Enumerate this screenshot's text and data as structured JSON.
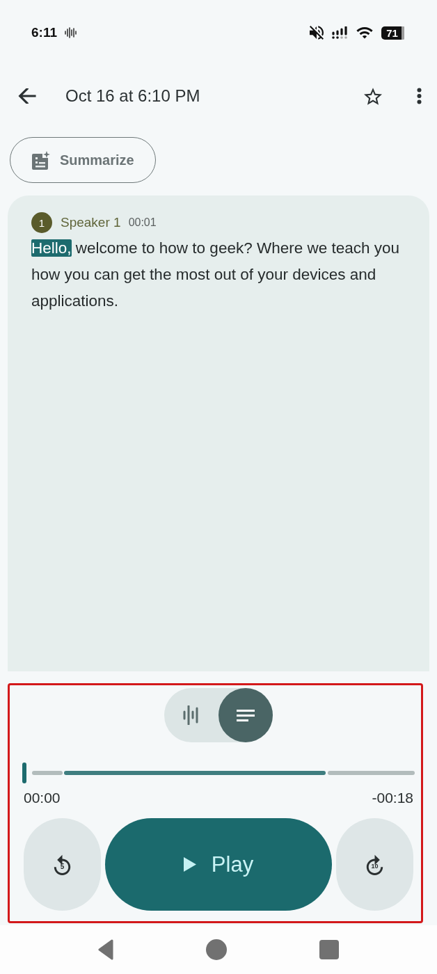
{
  "status_bar": {
    "time": "6:11",
    "battery": "71"
  },
  "header": {
    "title": "Oct 16 at 6:10 PM",
    "starred": false
  },
  "summarize_button": {
    "label": "Summarize"
  },
  "transcript": [
    {
      "badge": "1",
      "speaker": "Speaker 1",
      "time": "00:01",
      "words": [
        {
          "text": "Hello,",
          "highlighted": true
        },
        {
          "text": " welcome to how to geek? Where we teach you how you can get the most out of your devices and applications.",
          "highlighted": false
        }
      ]
    }
  ],
  "view_toggle": [
    {
      "kind": "waveform",
      "selected": false
    },
    {
      "kind": "transcript",
      "selected": true
    }
  ],
  "seek_bar": {
    "level": 0
  },
  "elapsed": "00:00",
  "remaining": "-00:18",
  "controls": [
    {
      "kind": "rewind",
      "label": "5"
    },
    {
      "kind": "play",
      "label": "Play"
    },
    {
      "kind": "forward",
      "label": "10"
    }
  ]
}
